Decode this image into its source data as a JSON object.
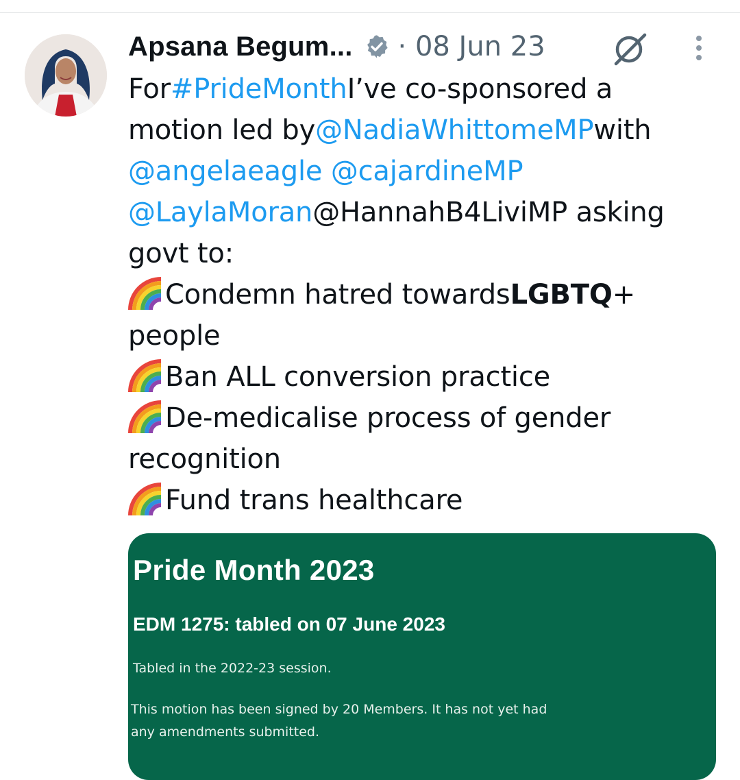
{
  "tweet": {
    "author_name": "Apsana Begum...",
    "meta": "· 08 Jun 23",
    "lines": {
      "l1_a": "For ",
      "l1_link": "#PrideMonth",
      "l1_b": " I’ve co-sponsored a",
      "l2_a": "motion led by ",
      "l2_link": "@NadiaWhittomeMP",
      "l2_b": " with",
      "l3_link1": "@angelaeagle",
      "l3_link2": "@cajardineMP",
      "l4_link": "@LaylaMoran",
      "l4_b": " @HannahB4LiviMP asking",
      "l5": "govt to:",
      "l6_a": "Condemn hatred towards ",
      "l6_bold": "LGBTQ",
      "l6_b": "+",
      "l7": "people",
      "l8": "Ban ALL conversion practice",
      "l9": "De-medicalise process of gender",
      "l10": "recognition",
      "l11": "Fund trans healthcare"
    }
  },
  "card": {
    "title": "Pride Month 2023",
    "subtitle": "EDM 1275: tabled on 07 June 2023",
    "session": "Tabled in the 2022-23 session.",
    "signed": "This motion has been signed by 20 Members. It has not yet had any amendments submitted."
  },
  "icons": {
    "verified": "verified-badge-icon",
    "grok": "grok-icon",
    "more": "more-options-icon",
    "rainbow": "rainbow-emoji-icon"
  },
  "colors": {
    "link": "#1d9bf0",
    "secondary_text": "#536471",
    "card_background": "#06664a"
  }
}
